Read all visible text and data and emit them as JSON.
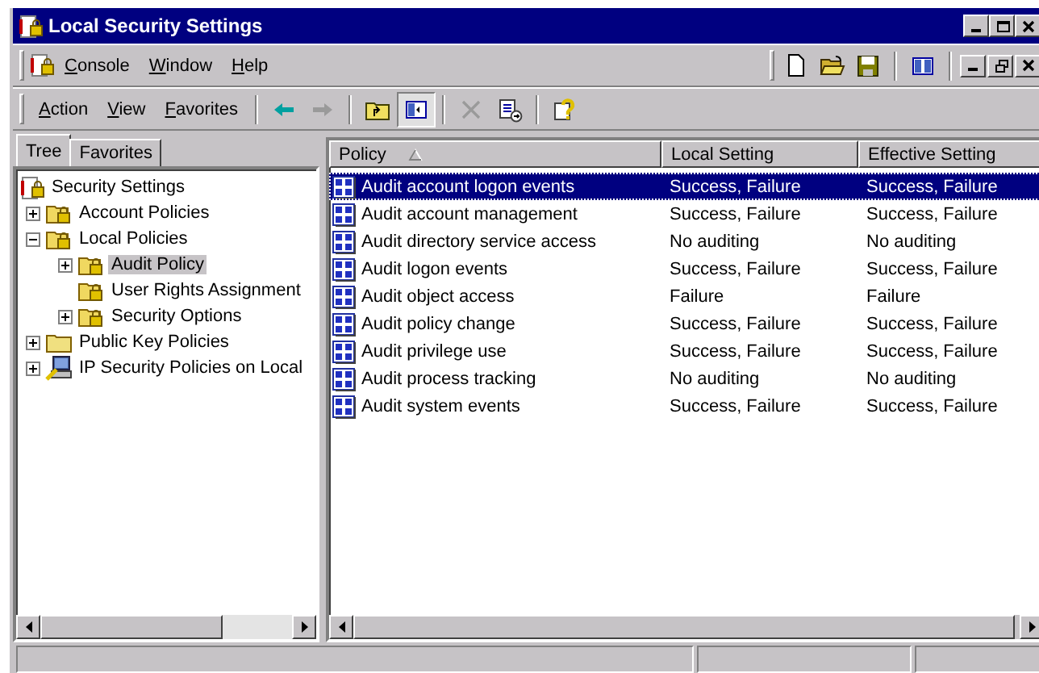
{
  "window": {
    "title": "Local Security Settings"
  },
  "menu_bar": {
    "items": [
      "Console",
      "Window",
      "Help"
    ]
  },
  "toolbar": {
    "menus": [
      "Action",
      "View",
      "Favorites"
    ],
    "buttons": [
      {
        "kind": "back",
        "disabled": false,
        "pressed": false
      },
      {
        "kind": "forward",
        "disabled": true,
        "pressed": false
      },
      {
        "kind": "separator"
      },
      {
        "kind": "up",
        "disabled": false,
        "pressed": false
      },
      {
        "kind": "tree",
        "disabled": false,
        "pressed": true
      },
      {
        "kind": "separator"
      },
      {
        "kind": "delete",
        "disabled": true,
        "pressed": false
      },
      {
        "kind": "export",
        "disabled": false,
        "pressed": false
      },
      {
        "kind": "separator"
      },
      {
        "kind": "help",
        "disabled": false,
        "pressed": false
      }
    ]
  },
  "tabs": [
    {
      "label": "Tree",
      "selected": true
    },
    {
      "label": "Favorites",
      "selected": false
    }
  ],
  "tree": {
    "label": "Security Settings",
    "kind": "root",
    "selected": false,
    "children": [
      {
        "label": "Account Policies",
        "kind": "folder",
        "expandable": true,
        "selected": false
      },
      {
        "label": "Local Policies",
        "kind": "folder",
        "expandable": true,
        "selected": false,
        "children": [
          {
            "label": "Audit Policy",
            "kind": "folder",
            "expandable": true,
            "selected": true
          },
          {
            "label": "User Rights Assignment",
            "kind": "folder",
            "expandable": false,
            "selected": false
          },
          {
            "label": "Security Options",
            "kind": "folder",
            "expandable": true,
            "selected": false
          }
        ]
      },
      {
        "label": "Public Key Policies",
        "kind": "plain-folder",
        "expandable": true,
        "selected": false
      },
      {
        "label": "IP Security Policies on Local",
        "kind": "computer",
        "expandable": true,
        "selected": false
      }
    ]
  },
  "list": {
    "columns": [
      {
        "label": "Policy",
        "sorted": true
      },
      {
        "label": "Local Setting",
        "sorted": false
      },
      {
        "label": "Effective Setting",
        "sorted": false
      }
    ],
    "rows": [
      {
        "cells": [
          "Audit account logon events",
          "Success, Failure",
          "Success, Failure"
        ],
        "selected": true
      },
      {
        "cells": [
          "Audit account management",
          "Success, Failure",
          "Success, Failure"
        ],
        "selected": false
      },
      {
        "cells": [
          "Audit directory service access",
          "No auditing",
          "No auditing"
        ],
        "selected": false
      },
      {
        "cells": [
          "Audit logon events",
          "Success, Failure",
          "Success, Failure"
        ],
        "selected": false
      },
      {
        "cells": [
          "Audit object access",
          "Failure",
          "Failure"
        ],
        "selected": false
      },
      {
        "cells": [
          "Audit policy change",
          "Success, Failure",
          "Success, Failure"
        ],
        "selected": false
      },
      {
        "cells": [
          "Audit privilege use",
          "Success, Failure",
          "Success, Failure"
        ],
        "selected": false
      },
      {
        "cells": [
          "Audit process tracking",
          "No auditing",
          "No auditing"
        ],
        "selected": false
      },
      {
        "cells": [
          "Audit system events",
          "Success, Failure",
          "Success, Failure"
        ],
        "selected": false
      }
    ]
  }
}
